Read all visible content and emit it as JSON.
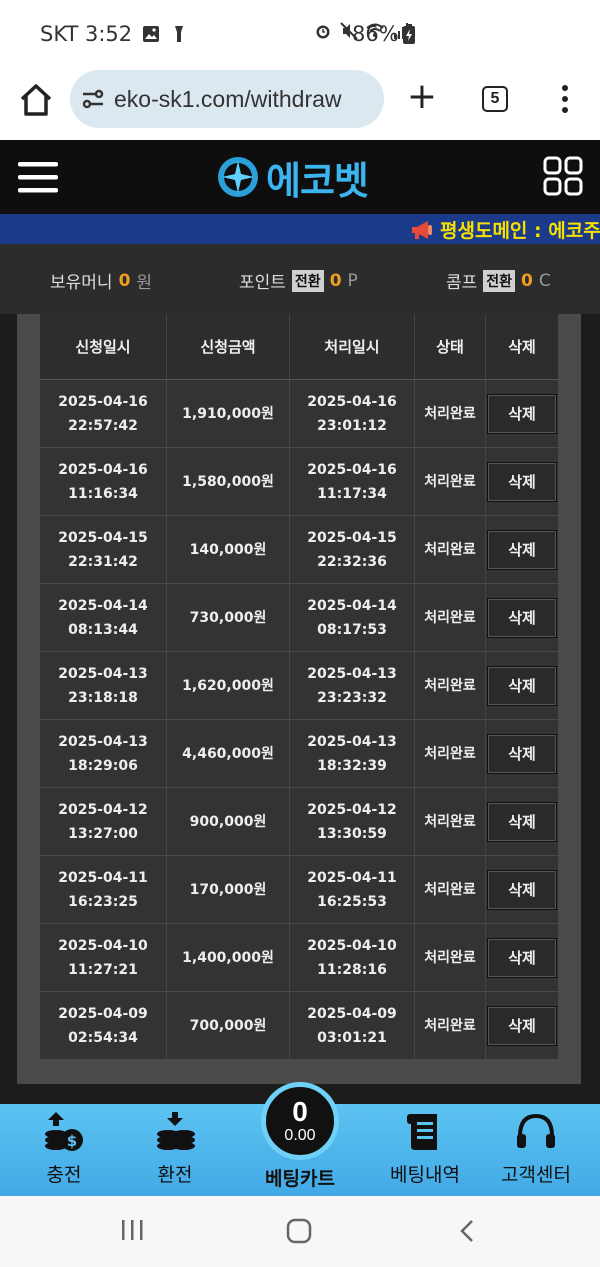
{
  "status_bar": {
    "carrier_time": "SKT 3:52",
    "battery": "86%"
  },
  "browser": {
    "url": "eko-sk1.com/withdraw",
    "tab_count": "5"
  },
  "site": {
    "logo_text": "에코벳"
  },
  "marquee": {
    "text": "평생도메인 : 에코주"
  },
  "balance": {
    "money_label": "보유머니",
    "money_value": "0",
    "money_unit": "원",
    "point_label": "포인트",
    "point_tag": "전환",
    "point_value": "0",
    "point_unit": "P",
    "comp_label": "콤프",
    "comp_tag": "전환",
    "comp_value": "0",
    "comp_unit": "C"
  },
  "table": {
    "headers": [
      "신청일시",
      "신청금액",
      "처리일시",
      "상태",
      "삭제"
    ],
    "rows": [
      {
        "req_date": "2025-04-16",
        "req_time": "22:57:42",
        "amount": "1,910,000원",
        "proc_date": "2025-04-16",
        "proc_time": "23:01:12",
        "status": "처리완료",
        "action": "삭제"
      },
      {
        "req_date": "2025-04-16",
        "req_time": "11:16:34",
        "amount": "1,580,000원",
        "proc_date": "2025-04-16",
        "proc_time": "11:17:34",
        "status": "처리완료",
        "action": "삭제"
      },
      {
        "req_date": "2025-04-15",
        "req_time": "22:31:42",
        "amount": "140,000원",
        "proc_date": "2025-04-15",
        "proc_time": "22:32:36",
        "status": "처리완료",
        "action": "삭제"
      },
      {
        "req_date": "2025-04-14",
        "req_time": "08:13:44",
        "amount": "730,000원",
        "proc_date": "2025-04-14",
        "proc_time": "08:17:53",
        "status": "처리완료",
        "action": "삭제"
      },
      {
        "req_date": "2025-04-13",
        "req_time": "23:18:18",
        "amount": "1,620,000원",
        "proc_date": "2025-04-13",
        "proc_time": "23:23:32",
        "status": "처리완료",
        "action": "삭제"
      },
      {
        "req_date": "2025-04-13",
        "req_time": "18:29:06",
        "amount": "4,460,000원",
        "proc_date": "2025-04-13",
        "proc_time": "18:32:39",
        "status": "처리완료",
        "action": "삭제"
      },
      {
        "req_date": "2025-04-12",
        "req_time": "13:27:00",
        "amount": "900,000원",
        "proc_date": "2025-04-12",
        "proc_time": "13:30:59",
        "status": "처리완료",
        "action": "삭제"
      },
      {
        "req_date": "2025-04-11",
        "req_time": "16:23:25",
        "amount": "170,000원",
        "proc_date": "2025-04-11",
        "proc_time": "16:25:53",
        "status": "처리완료",
        "action": "삭제"
      },
      {
        "req_date": "2025-04-10",
        "req_time": "11:27:21",
        "amount": "1,400,000원",
        "proc_date": "2025-04-10",
        "proc_time": "11:28:16",
        "status": "처리완료",
        "action": "삭제"
      },
      {
        "req_date": "2025-04-09",
        "req_time": "02:54:34",
        "amount": "700,000원",
        "proc_date": "2025-04-09",
        "proc_time": "03:01:21",
        "status": "처리완료",
        "action": "삭제"
      }
    ]
  },
  "bottom_nav": {
    "charge": "충전",
    "exchange": "환전",
    "bet_cart_label": "베팅카트",
    "bet_cart_count": "0",
    "bet_cart_amount": "0.00",
    "bet_history": "베팅내역",
    "support": "고객센터"
  }
}
